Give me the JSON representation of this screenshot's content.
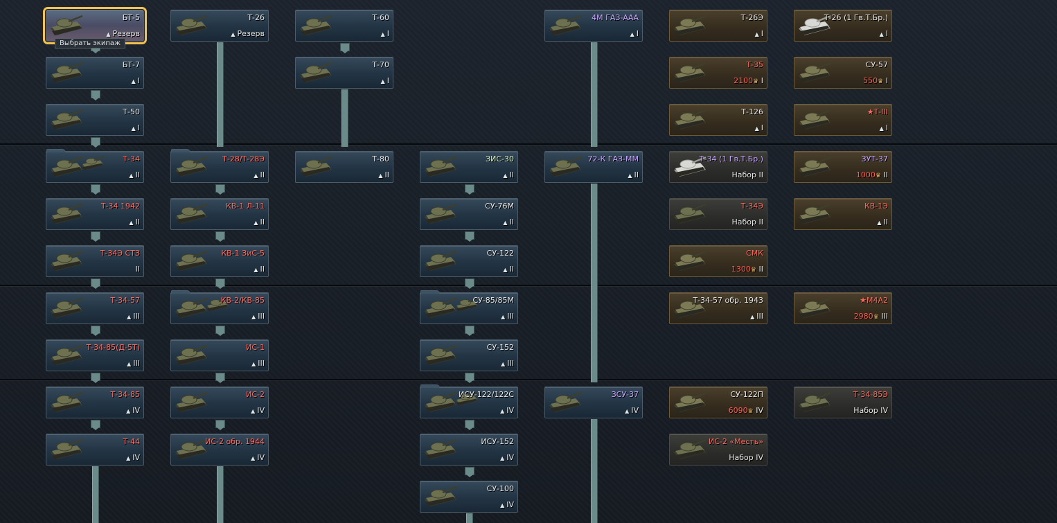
{
  "tooltip": "Выбрать экипаж",
  "colors": {
    "accent_selected": "#f2c14e",
    "premium_name": "#ff6a5e",
    "price": "#ff5a4a",
    "event_name": "#c9a6ff"
  },
  "icons": {
    "rank": "rank-chevron-icon",
    "eagle": "golden-eagle-icon"
  },
  "vehicles": [
    {
      "id": "bt5",
      "name": "БТ-5",
      "status": "Резерв",
      "kind": "tech",
      "color": "white",
      "selected": true
    },
    {
      "id": "t26",
      "name": "Т-26",
      "status": "Резерв",
      "kind": "tech",
      "color": "white"
    },
    {
      "id": "t60",
      "name": "Т-60",
      "rank": "I",
      "kind": "tech",
      "color": "white"
    },
    {
      "id": "gaz_aaa",
      "name": "4М ГАЗ-ААА",
      "rank": "I",
      "kind": "tech",
      "color": "purple"
    },
    {
      "id": "t26e",
      "name": "Т-26Э",
      "rank": "I",
      "kind": "prem",
      "color": "white"
    },
    {
      "id": "t26_gv",
      "name": "Т-26 (1 Гв.Т.Бр.)",
      "rank": "I",
      "kind": "prem",
      "color": "white"
    },
    {
      "id": "bt7",
      "name": "БТ-7",
      "rank": "I",
      "kind": "tech",
      "color": "white"
    },
    {
      "id": "t70",
      "name": "Т-70",
      "rank": "I",
      "kind": "tech",
      "color": "white"
    },
    {
      "id": "t35",
      "name": "Т-35",
      "price": "2100",
      "rank": "I",
      "kind": "prem",
      "color": "red"
    },
    {
      "id": "su57",
      "name": "СУ-57",
      "price": "550",
      "rank": "I",
      "kind": "prem",
      "color": "white"
    },
    {
      "id": "t50",
      "name": "Т-50",
      "rank": "I",
      "kind": "tech",
      "color": "white"
    },
    {
      "id": "t126",
      "name": "Т-126",
      "rank": "I",
      "kind": "prem",
      "color": "white"
    },
    {
      "id": "t3",
      "name": "★Т-III",
      "rank": "I",
      "kind": "prem",
      "color": "red"
    },
    {
      "id": "t34",
      "name": "Т-34",
      "rank": "II",
      "kind": "tech",
      "color": "red",
      "folder": true
    },
    {
      "id": "t28",
      "name": "Т-28/Т-28Э",
      "rank": "II",
      "kind": "tech",
      "color": "red",
      "folder": true
    },
    {
      "id": "t80",
      "name": "Т-80",
      "rank": "II",
      "kind": "tech",
      "color": "white"
    },
    {
      "id": "zis30",
      "name": "ЗИС-30",
      "rank": "II",
      "kind": "tech",
      "color": "green"
    },
    {
      "id": "gaz_mm",
      "name": "72-К ГАЗ-ММ",
      "rank": "II",
      "kind": "tech",
      "color": "purple"
    },
    {
      "id": "t34_gv",
      "name": "Т-34 (1 Гв.Т.Бр.)",
      "status": "Набор II",
      "kind": "pack",
      "color": "purple"
    },
    {
      "id": "zut37",
      "name": "ЗУТ-37",
      "price": "1000",
      "rank": "II",
      "kind": "prem",
      "color": "purple"
    },
    {
      "id": "t34_1942",
      "name": "Т-34 1942",
      "rank": "II",
      "kind": "tech",
      "color": "red"
    },
    {
      "id": "kv1_l11",
      "name": "КВ-1 Л-11",
      "rank": "II",
      "kind": "tech",
      "color": "red"
    },
    {
      "id": "su76m",
      "name": "СУ-76М",
      "rank": "II",
      "kind": "tech",
      "color": "white"
    },
    {
      "id": "t34e",
      "name": "Т-34Э",
      "status": "Набор II",
      "kind": "pack",
      "color": "red"
    },
    {
      "id": "kv1e",
      "name": "КВ-1Э",
      "rank": "II",
      "kind": "prem",
      "color": "red"
    },
    {
      "id": "t34e_stz",
      "name": "Т-34Э СТЗ",
      "rank": "II",
      "kind": "tech",
      "color": "red"
    },
    {
      "id": "kv1_zis5",
      "name": "КВ-1 ЗиС-5",
      "rank": "II",
      "kind": "tech",
      "color": "red"
    },
    {
      "id": "su122",
      "name": "СУ-122",
      "rank": "II",
      "kind": "tech",
      "color": "white"
    },
    {
      "id": "smk",
      "name": "СМК",
      "price": "1300",
      "rank": "II",
      "kind": "prem",
      "color": "red"
    },
    {
      "id": "t34_57",
      "name": "Т-34-57",
      "rank": "III",
      "kind": "tech",
      "color": "red"
    },
    {
      "id": "kv2_kv85",
      "name": "КВ-2/КВ-85",
      "rank": "III",
      "kind": "tech",
      "color": "red",
      "folder": true
    },
    {
      "id": "su85",
      "name": "СУ-85/85М",
      "rank": "III",
      "kind": "tech",
      "color": "white",
      "folder": true
    },
    {
      "id": "t34_57_43",
      "name": "Т-34-57 обр. 1943",
      "rank": "III",
      "kind": "prem",
      "color": "white"
    },
    {
      "id": "m4a2",
      "name": "★M4A2",
      "price": "2980",
      "rank": "III",
      "kind": "prem",
      "color": "red"
    },
    {
      "id": "t34_85d5t",
      "name": "Т-34-85(Д-5Т)",
      "rank": "III",
      "kind": "tech",
      "color": "red"
    },
    {
      "id": "is1",
      "name": "ИС-1",
      "rank": "III",
      "kind": "tech",
      "color": "red"
    },
    {
      "id": "su152",
      "name": "СУ-152",
      "rank": "III",
      "kind": "tech",
      "color": "white"
    },
    {
      "id": "t34_85",
      "name": "Т-34-85",
      "rank": "IV",
      "kind": "tech",
      "color": "red"
    },
    {
      "id": "is2",
      "name": "ИС-2",
      "rank": "IV",
      "kind": "tech",
      "color": "red"
    },
    {
      "id": "isu122",
      "name": "ИСУ-122/122С",
      "rank": "IV",
      "kind": "tech",
      "color": "white",
      "folder": true
    },
    {
      "id": "zsu37",
      "name": "ЗСУ-37",
      "rank": "IV",
      "kind": "tech",
      "color": "purple"
    },
    {
      "id": "su122p",
      "name": "СУ-122П",
      "price": "6090",
      "rank": "IV",
      "kind": "prem",
      "color": "white"
    },
    {
      "id": "t34_85e",
      "name": "Т-34-85Э",
      "status": "Набор IV",
      "kind": "pack",
      "color": "red"
    },
    {
      "id": "t44",
      "name": "Т-44",
      "rank": "IV",
      "kind": "tech",
      "color": "red"
    },
    {
      "id": "is2_44",
      "name": "ИС-2 обр. 1944",
      "rank": "IV",
      "kind": "tech",
      "color": "red"
    },
    {
      "id": "isu152",
      "name": "ИСУ-152",
      "rank": "IV",
      "kind": "tech",
      "color": "white"
    },
    {
      "id": "is2_mest",
      "name": "ИС-2 «Месть»",
      "status": "Набор IV",
      "kind": "pack",
      "color": "red"
    },
    {
      "id": "su100",
      "name": "СУ-100",
      "rank": "IV",
      "kind": "tech",
      "color": "white"
    }
  ]
}
